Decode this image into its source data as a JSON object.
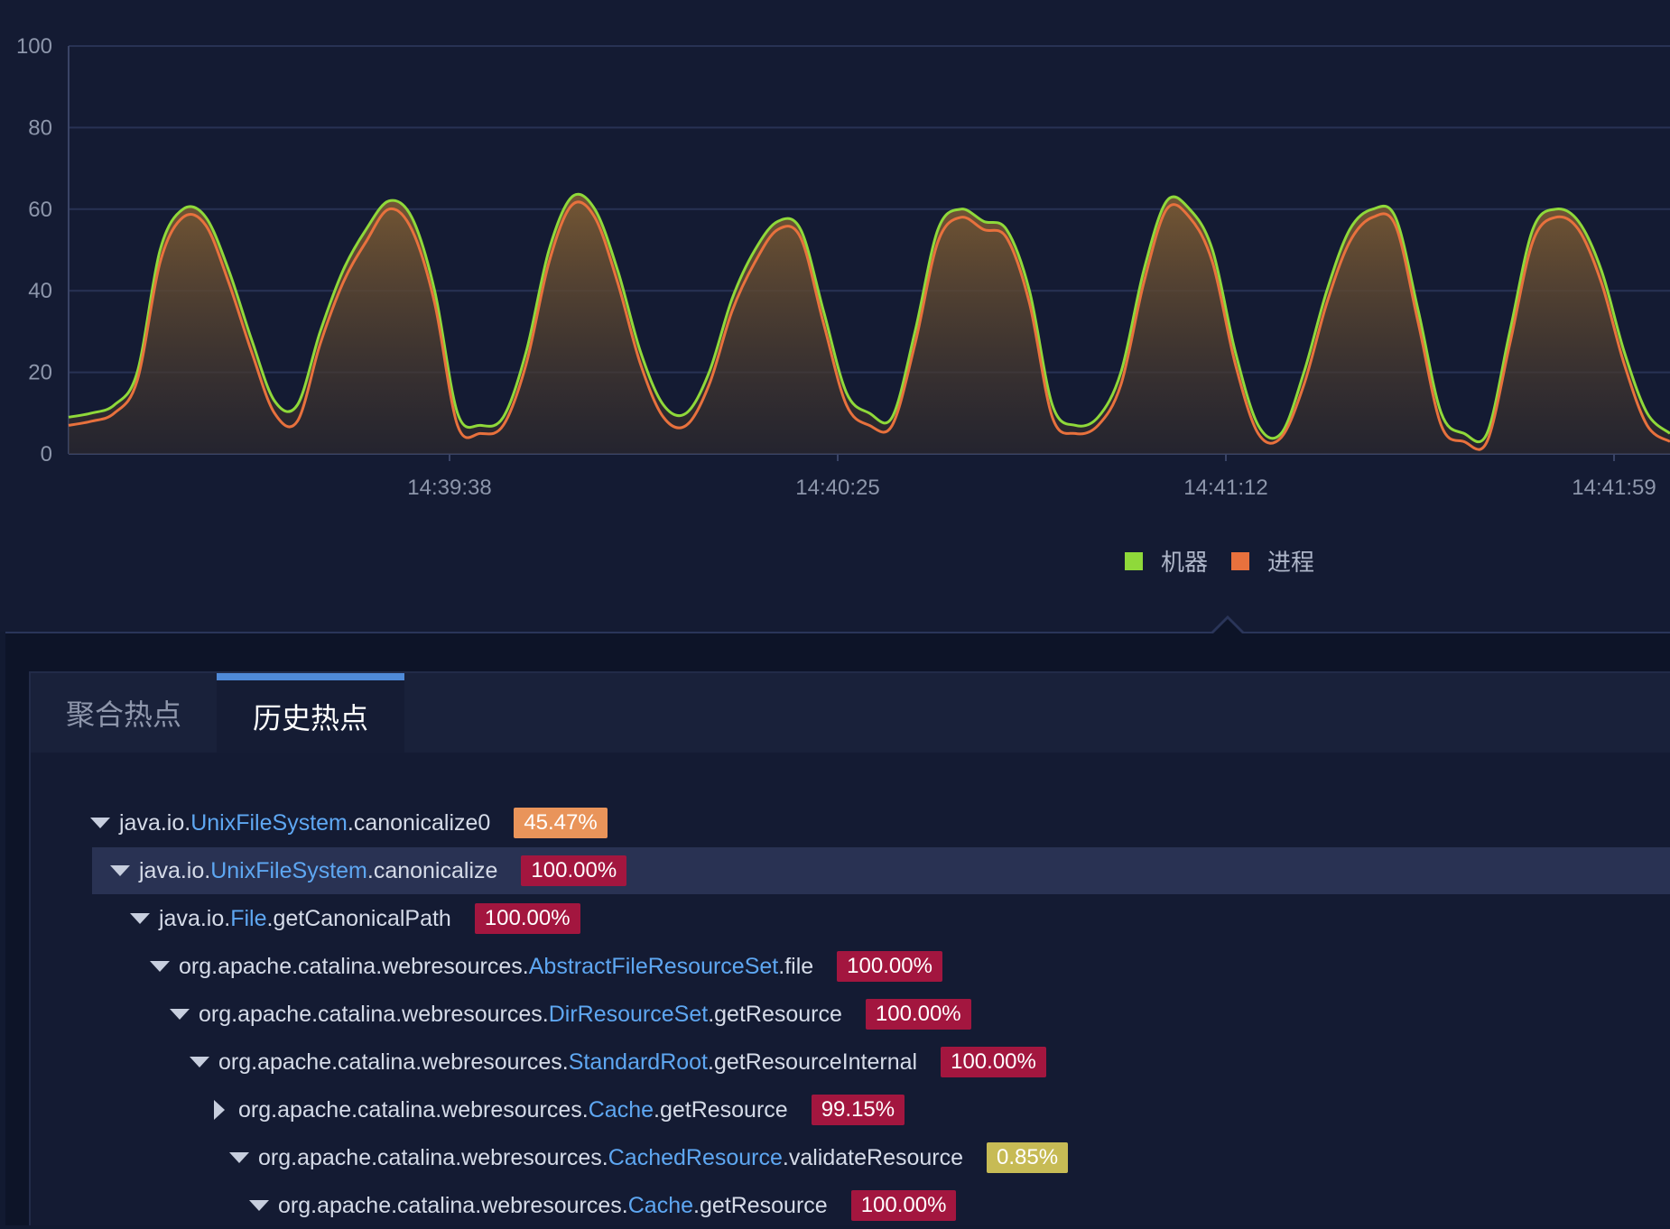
{
  "chart_data": {
    "type": "area",
    "title": "",
    "xlabel": "",
    "ylabel": "",
    "ylim": [
      0,
      100
    ],
    "yticks": [
      0,
      20,
      40,
      60,
      80,
      100
    ],
    "x_tick_labels": [
      "14:39:38",
      "14:40:25",
      "14:41:12",
      "14:41:59"
    ],
    "legend_position": "bottom-right",
    "grid": true,
    "series": [
      {
        "name": "机器",
        "color": "#8fd93a",
        "values": [
          9,
          10,
          12,
          20,
          50,
          60,
          58,
          45,
          28,
          13,
          12,
          30,
          45,
          55,
          62,
          58,
          40,
          10,
          7,
          9,
          25,
          50,
          63,
          60,
          45,
          25,
          12,
          10,
          20,
          38,
          50,
          57,
          55,
          35,
          15,
          10,
          9,
          30,
          55,
          60,
          57,
          55,
          40,
          12,
          7,
          9,
          20,
          45,
          62,
          60,
          50,
          25,
          7,
          5,
          20,
          40,
          55,
          60,
          58,
          35,
          10,
          5,
          5,
          30,
          55,
          60,
          57,
          45,
          25,
          10,
          5
        ]
      },
      {
        "name": "进程",
        "color": "#e8713d",
        "values": [
          7,
          8,
          10,
          18,
          47,
          58,
          56,
          42,
          25,
          10,
          8,
          27,
          42,
          52,
          60,
          55,
          37,
          7,
          5,
          7,
          22,
          47,
          61,
          58,
          42,
          22,
          9,
          7,
          17,
          35,
          47,
          55,
          53,
          32,
          12,
          7,
          7,
          27,
          52,
          58,
          55,
          53,
          37,
          9,
          5,
          7,
          17,
          42,
          60,
          58,
          47,
          22,
          5,
          4,
          17,
          37,
          52,
          58,
          56,
          32,
          7,
          3,
          3,
          27,
          52,
          58,
          55,
          42,
          22,
          7,
          3
        ]
      }
    ]
  },
  "tabs": [
    {
      "label": "聚合热点"
    },
    {
      "label": "历史热点"
    }
  ],
  "tree": [
    {
      "pkg": "java.io.",
      "cls": "UnixFileSystem",
      "method": ".canonicalize0",
      "pct": "45.47%",
      "pct_color": "#e9945a"
    },
    {
      "pkg": "java.io.",
      "cls": "UnixFileSystem",
      "method": ".canonicalize",
      "pct": "100.00%",
      "pct_color": "#a3163f"
    },
    {
      "pkg": "java.io.",
      "cls": "File",
      "method": ".getCanonicalPath",
      "pct": "100.00%",
      "pct_color": "#a3163f"
    },
    {
      "pkg": "org.apache.catalina.webresources.",
      "cls": "AbstractFileResourceSet",
      "method": ".file",
      "pct": "100.00%",
      "pct_color": "#a3163f"
    },
    {
      "pkg": "org.apache.catalina.webresources.",
      "cls": "DirResourceSet",
      "method": ".getResource",
      "pct": "100.00%",
      "pct_color": "#a3163f"
    },
    {
      "pkg": "org.apache.catalina.webresources.",
      "cls": "StandardRoot",
      "method": ".getResourceInternal",
      "pct": "100.00%",
      "pct_color": "#a3163f"
    },
    {
      "pkg": "org.apache.catalina.webresources.",
      "cls": "Cache",
      "method": ".getResource",
      "pct": "99.15%",
      "pct_color": "#a3163f"
    },
    {
      "pkg": "org.apache.catalina.webresources.",
      "cls": "CachedResource",
      "method": ".validateResource",
      "pct": "0.85%",
      "pct_color": "#c7bb55"
    },
    {
      "pkg": "org.apache.catalina.webresources.",
      "cls": "Cache",
      "method": ".getResource",
      "pct": "100.00%",
      "pct_color": "#a3163f"
    }
  ]
}
